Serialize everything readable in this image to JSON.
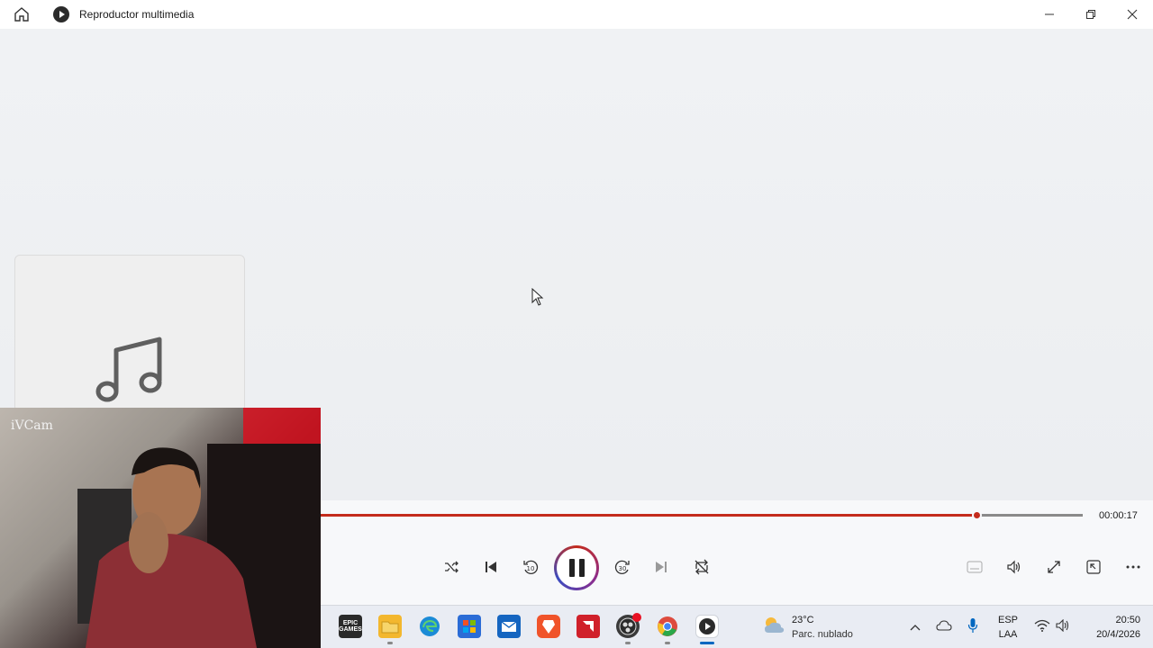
{
  "window": {
    "title": "Reproductor multimedia",
    "controls": [
      "minimize-icon",
      "restore-icon",
      "close-icon"
    ]
  },
  "main": {
    "album_art_icon": "music-note-icon"
  },
  "webcam": {
    "label": "iVCam"
  },
  "player": {
    "time": "00:00:17",
    "progress": 0.86,
    "accent_color": "#c42b1c",
    "controls": [
      "shuffle-icon",
      "previous-icon",
      "rewind-10-icon",
      "pause-icon",
      "forward-30-icon",
      "next-icon",
      "repeat-icon"
    ],
    "right_controls": [
      "captions-icon",
      "volume-icon",
      "fullscreen-icon",
      "miniplayer-icon",
      "more-icon"
    ]
  },
  "taskbar": {
    "apps": [
      {
        "name": "Epic Games",
        "color": "#2a2a2a"
      },
      {
        "name": "File Explorer",
        "color": "#f3b72e"
      },
      {
        "name": "Microsoft Edge",
        "color": "#1b8bd6"
      },
      {
        "name": "Microsoft Store",
        "color": "#2b6cd6"
      },
      {
        "name": "Outlook",
        "color": "#1565c0"
      },
      {
        "name": "Brave",
        "color": "#f0532a"
      },
      {
        "name": "AMD",
        "color": "#d0202a"
      },
      {
        "name": "OBS Studio",
        "color": "#3a3a3a"
      },
      {
        "name": "Google Chrome",
        "color": "#dd4b3e"
      },
      {
        "name": "Reproductor multimedia",
        "color": "#2b2b2b"
      }
    ],
    "epic_label": "EPIC\nGAMES",
    "weather": {
      "temp": "23°C",
      "desc": "Parc. nublado"
    },
    "language": {
      "lang": "ESP",
      "layout": "LAA"
    },
    "clock": {
      "time": "20:50",
      "date": "20/4/2026"
    }
  }
}
